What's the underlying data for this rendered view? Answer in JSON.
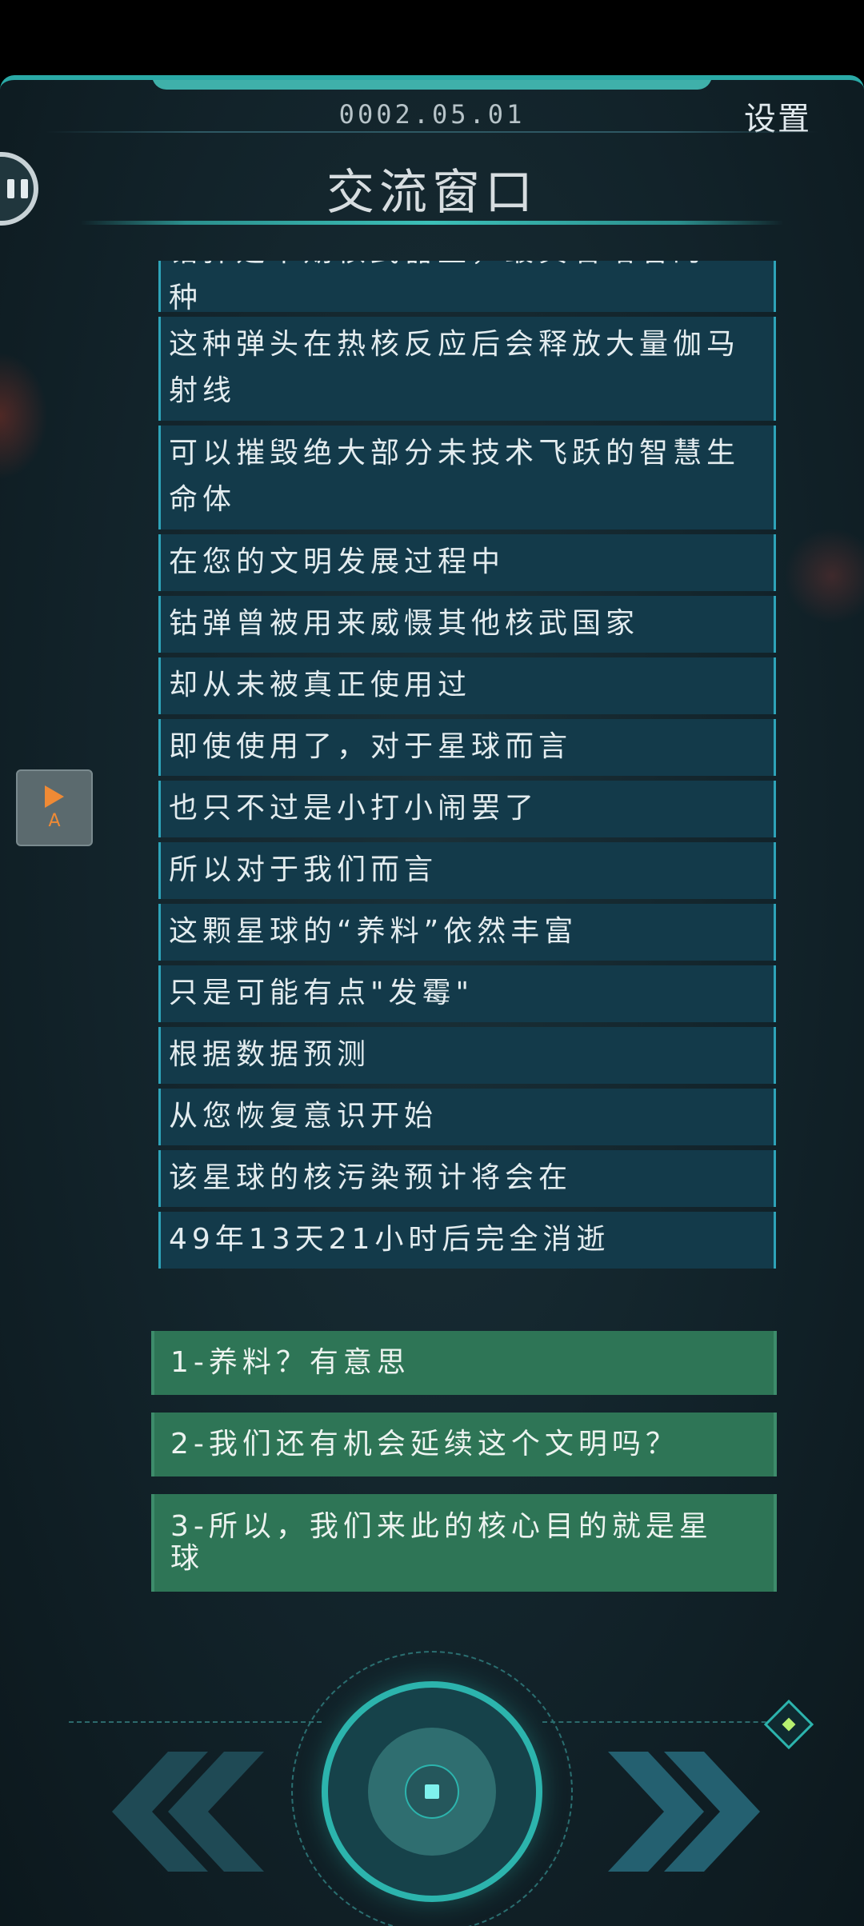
{
  "header": {
    "timestamp": "0002.05.01",
    "settings_label": "设置",
    "title": "交流窗口"
  },
  "messages": [
    {
      "line1": "钴弹是中期核武器里，最真名昭著的一",
      "line2": "种",
      "kind": "partial"
    },
    {
      "line1": "这种弹头在热核反应后会释放大量伽马",
      "line2": "射线",
      "kind": "double"
    },
    {
      "line1": "可以摧毁绝大部分未技术飞跃的智慧生",
      "line2": "命体",
      "kind": "double"
    },
    {
      "line1": "在您的文明发展过程中",
      "kind": "single"
    },
    {
      "line1": "钴弹曾被用来威慑其他核武国家",
      "kind": "single"
    },
    {
      "line1": "却从未被真正使用过",
      "kind": "single"
    },
    {
      "line1": "即使使用了，对于星球而言",
      "kind": "single"
    },
    {
      "line1": "也只不过是小打小闹罢了",
      "kind": "single"
    },
    {
      "line1": "所以对于我们而言",
      "kind": "single"
    },
    {
      "line1": "这颗星球的“养料”依然丰富",
      "kind": "single"
    },
    {
      "line1": "只是可能有点\"发霉\"",
      "kind": "single"
    },
    {
      "line1": "根据数据预测",
      "kind": "single"
    },
    {
      "line1": "从您恢复意识开始",
      "kind": "single"
    },
    {
      "line1": "该星球的核污染预计将会在",
      "kind": "single"
    },
    {
      "line1": "49年13天21小时后完全消逝",
      "kind": "single"
    }
  ],
  "choices": [
    {
      "text": "1-养料？有意思"
    },
    {
      "text": "2-我们还有机会延续这个文明吗？"
    },
    {
      "text": "3-所以，我们来此的核心目的就是星",
      "text2": "球"
    }
  ],
  "auto_button": {
    "label": "A"
  },
  "colors": {
    "accent": "#2cb4ad",
    "message_bg": "#133a4a",
    "choice_bg": "#2e7556",
    "auto_icon": "#ef8a35"
  },
  "icons": {
    "pause": "pause-icon",
    "auto_play": "play-icon",
    "prev": "double-chevron-left-icon",
    "next": "double-chevron-right-icon",
    "center": "dial-icon",
    "diamond": "diamond-icon"
  }
}
